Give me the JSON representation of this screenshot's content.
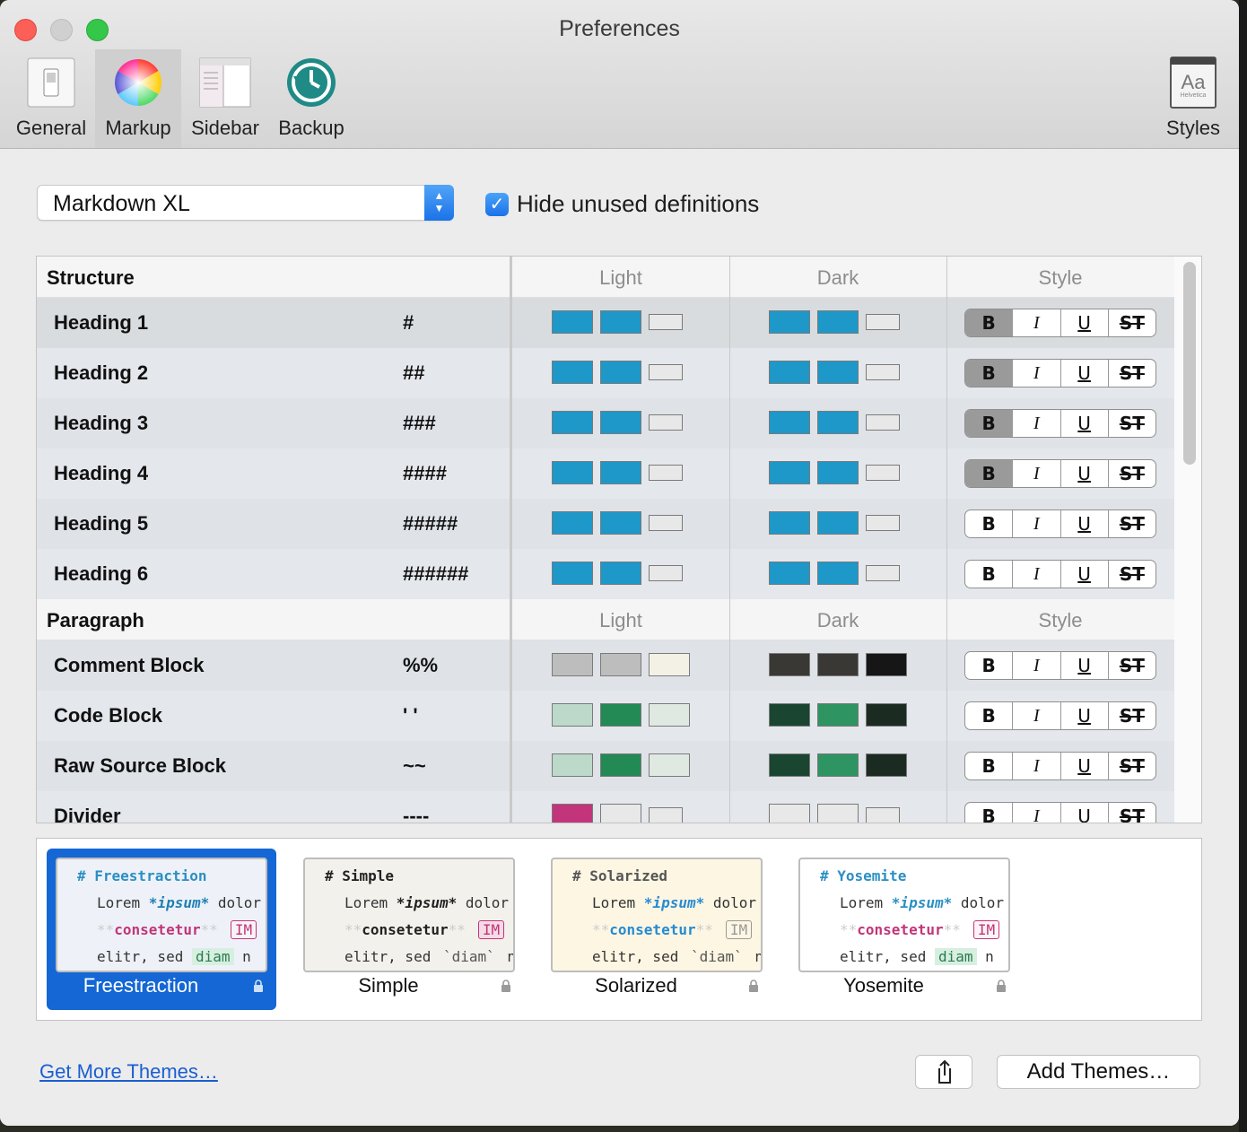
{
  "window": {
    "title": "Preferences"
  },
  "toolbar": {
    "items": [
      {
        "label": "General",
        "icon": "switch-icon"
      },
      {
        "label": "Markup",
        "icon": "color-wheel-icon",
        "active": true
      },
      {
        "label": "Sidebar",
        "icon": "sidebar-icon"
      },
      {
        "label": "Backup",
        "icon": "time-machine-icon"
      }
    ],
    "styles": {
      "label": "Styles",
      "icon_text": "Aa",
      "icon_subtext": "Helvetica"
    }
  },
  "controls": {
    "syntax_select": "Markdown XL",
    "hide_unused_label": "Hide unused definitions",
    "hide_unused_checked": true
  },
  "table": {
    "columns": {
      "light": "Light",
      "dark": "Dark",
      "style": "Style"
    },
    "sections": [
      {
        "title": "Structure",
        "rows": [
          {
            "name": "Heading 1",
            "mark": "#",
            "light": [
              "#1e98c9",
              "#1e98c9",
              "#e8e8e8"
            ],
            "dark": [
              "#1e98c9",
              "#1e98c9",
              "#e8e8e8"
            ],
            "bold": true
          },
          {
            "name": "Heading 2",
            "mark": "##",
            "light": [
              "#1e98c9",
              "#1e98c9",
              "#e8e8e8"
            ],
            "dark": [
              "#1e98c9",
              "#1e98c9",
              "#e8e8e8"
            ],
            "bold": true
          },
          {
            "name": "Heading 3",
            "mark": "###",
            "light": [
              "#1e98c9",
              "#1e98c9",
              "#e8e8e8"
            ],
            "dark": [
              "#1e98c9",
              "#1e98c9",
              "#e8e8e8"
            ],
            "bold": true
          },
          {
            "name": "Heading 4",
            "mark": "####",
            "light": [
              "#1e98c9",
              "#1e98c9",
              "#e8e8e8"
            ],
            "dark": [
              "#1e98c9",
              "#1e98c9",
              "#e8e8e8"
            ],
            "bold": true
          },
          {
            "name": "Heading 5",
            "mark": "#####",
            "light": [
              "#1e98c9",
              "#1e98c9",
              "#e8e8e8"
            ],
            "dark": [
              "#1e98c9",
              "#1e98c9",
              "#e8e8e8"
            ],
            "bold": false
          },
          {
            "name": "Heading 6",
            "mark": "######",
            "light": [
              "#1e98c9",
              "#1e98c9",
              "#e8e8e8"
            ],
            "dark": [
              "#1e98c9",
              "#1e98c9",
              "#e8e8e8"
            ],
            "bold": false
          }
        ]
      },
      {
        "title": "Paragraph",
        "rows": [
          {
            "name": "Comment Block",
            "mark": "%%",
            "light": [
              "#bdbdbd",
              "#bdbdbd",
              "#f3f1e6"
            ],
            "dark": [
              "#3a3835",
              "#3a3835",
              "#161616"
            ],
            "bold": false
          },
          {
            "name": "Code Block",
            "mark": "' '",
            "light": [
              "#bcd9c9",
              "#238a55",
              "#dfe9e2"
            ],
            "dark": [
              "#1a4631",
              "#2e9462",
              "#1b2b22"
            ],
            "bold": false
          },
          {
            "name": "Raw Source Block",
            "mark": "~~",
            "light": [
              "#bcd9c9",
              "#238a55",
              "#dfe9e2"
            ],
            "dark": [
              "#1a4631",
              "#2e9462",
              "#1b2b22"
            ],
            "bold": false
          },
          {
            "name": "Divider",
            "mark": "----",
            "light": [
              "#c2357a",
              "#e8e8e8",
              "#e8e8e8"
            ],
            "dark": [
              "#e8e8e8",
              "#e8e8e8",
              "#e8e8e8"
            ],
            "bold": false
          }
        ]
      }
    ],
    "style_buttons": {
      "b": "B",
      "i": "I",
      "u": "U",
      "st": "ST"
    }
  },
  "themes": [
    {
      "name": "Freestraction",
      "selected": true,
      "bg": "#eef2f8",
      "heading": "# Freestraction",
      "line2": [
        "Lorem ",
        "*ipsum*",
        " dolor"
      ],
      "line3": [
        "**",
        "consetetur",
        "**",
        "IM"
      ],
      "line4": [
        "elitr, sed ",
        "diam",
        " n"
      ]
    },
    {
      "name": "Simple",
      "selected": false,
      "bg": "#f3f1ec",
      "heading": "# Simple",
      "line2": [
        "Lorem ",
        "*ipsum*",
        " dolor"
      ],
      "line3": [
        "**",
        "consetetur",
        "**",
        "IM"
      ],
      "line4": [
        "elitr, sed ",
        "`diam`",
        " n"
      ]
    },
    {
      "name": "Solarized",
      "selected": false,
      "bg": "#fdf6e3",
      "heading": "# Solarized",
      "line2": [
        "Lorem ",
        "*ipsum*",
        " dolor"
      ],
      "line3": [
        "**",
        "consetetur",
        "**",
        "IM"
      ],
      "line4": [
        "elitr, sed ",
        "`diam`",
        " n"
      ]
    },
    {
      "name": "Yosemite",
      "selected": false,
      "bg": "#ffffff",
      "heading": "# Yosemite",
      "line2": [
        "Lorem ",
        "*ipsum*",
        " dolor"
      ],
      "line3": [
        "**",
        "consetetur",
        "**",
        "IM"
      ],
      "line4": [
        "elitr, sed ",
        "diam",
        " n"
      ]
    }
  ],
  "footer": {
    "get_more": "Get More Themes…",
    "add_themes": "Add Themes…"
  }
}
